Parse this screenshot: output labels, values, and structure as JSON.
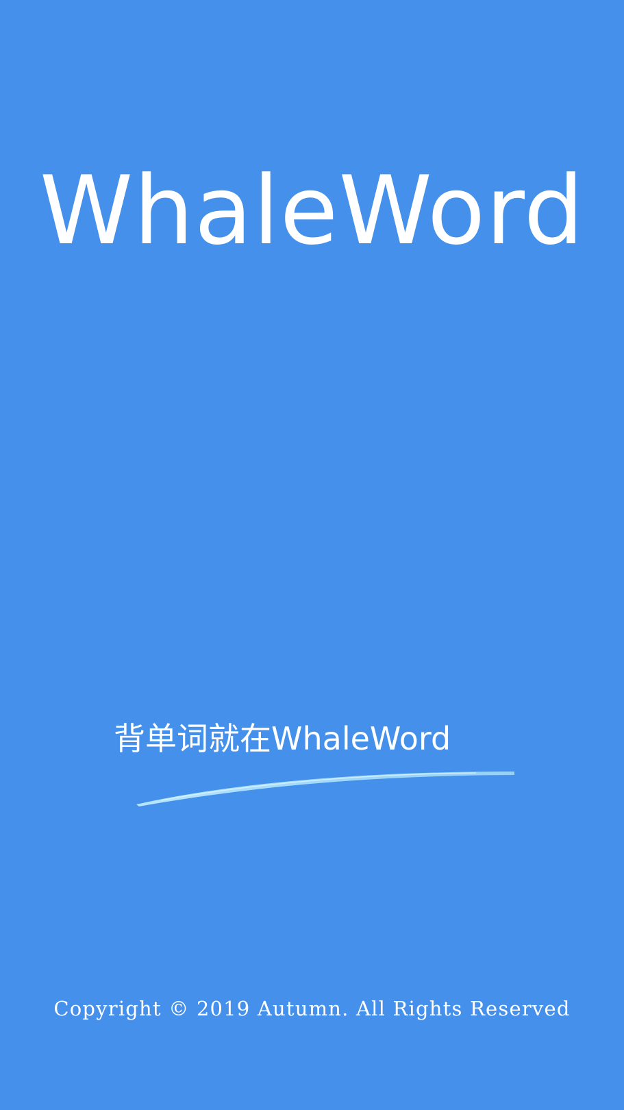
{
  "splash": {
    "app_title": "WhaleWord",
    "slogan": "背单词就在WhaleWord",
    "copyright": "Copyright © 2019 Autumn. All Rights Reserved"
  },
  "colors": {
    "background": "#4590EA",
    "text": "#FFFFFF",
    "swoosh_light": "#BDEBFF",
    "swoosh_mid": "#7FCBF5"
  }
}
